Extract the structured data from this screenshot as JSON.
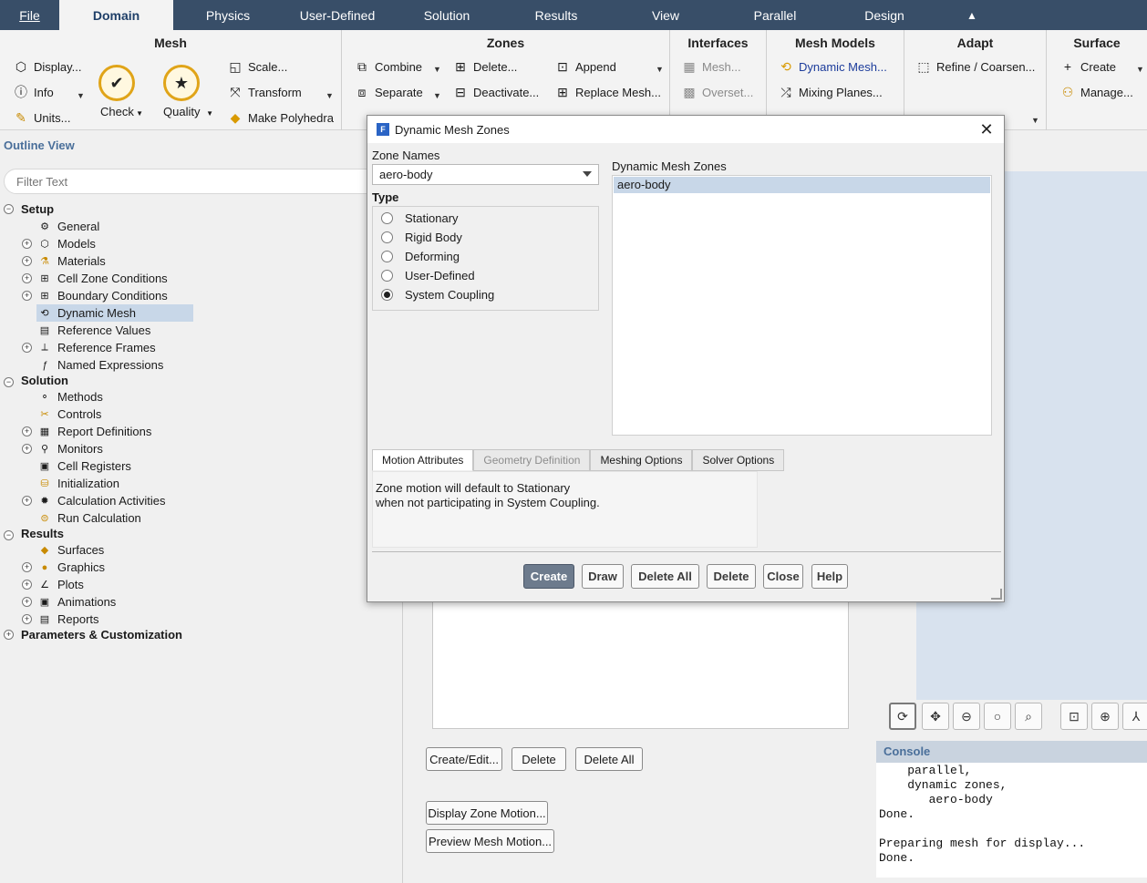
{
  "menu": {
    "tabs": [
      "File",
      "Domain",
      "Physics",
      "User-Defined",
      "Solution",
      "Results",
      "View",
      "Parallel",
      "Design"
    ],
    "active": "Domain",
    "collapse_glyph": "▲"
  },
  "ribbon": {
    "mesh": {
      "title": "Mesh",
      "display": "Display...",
      "info": "Info",
      "units": "Units...",
      "check": "Check",
      "quality": "Quality",
      "scale": "Scale...",
      "transform": "Transform",
      "polyhedra": "Make Polyhedra"
    },
    "zones": {
      "title": "Zones",
      "combine": "Combine",
      "separate": "Separate",
      "delete": "Delete...",
      "deactivate": "Deactivate...",
      "append": "Append",
      "replace_mesh": "Replace Mesh..."
    },
    "interfaces": {
      "title": "Interfaces",
      "mesh": "Mesh...",
      "overset": "Overset..."
    },
    "mesh_models": {
      "title": "Mesh Models",
      "dynamic_mesh": "Dynamic Mesh...",
      "mixing_planes": "Mixing Planes..."
    },
    "adapt": {
      "title": "Adapt",
      "refine": "Refine / Coarsen..."
    },
    "surface": {
      "title": "Surface",
      "create": "Create",
      "manage": "Manage..."
    }
  },
  "outline": {
    "title": "Outline View",
    "filter_placeholder": "Filter Text",
    "nodes": [
      {
        "label": "Setup"
      },
      {
        "label": "General"
      },
      {
        "label": "Models"
      },
      {
        "label": "Materials"
      },
      {
        "label": "Cell Zone Conditions"
      },
      {
        "label": "Boundary Conditions"
      },
      {
        "label": "Dynamic Mesh"
      },
      {
        "label": "Reference Values"
      },
      {
        "label": "Reference Frames"
      },
      {
        "label": "Named Expressions"
      },
      {
        "label": "Solution"
      },
      {
        "label": "Methods"
      },
      {
        "label": "Controls"
      },
      {
        "label": "Report Definitions"
      },
      {
        "label": "Monitors"
      },
      {
        "label": "Cell Registers"
      },
      {
        "label": "Initialization"
      },
      {
        "label": "Calculation Activities"
      },
      {
        "label": "Run Calculation"
      },
      {
        "label": "Results"
      },
      {
        "label": "Surfaces"
      },
      {
        "label": "Graphics"
      },
      {
        "label": "Plots"
      },
      {
        "label": "Animations"
      },
      {
        "label": "Reports"
      },
      {
        "label": "Parameters & Customization"
      }
    ]
  },
  "task_page": {
    "create_edit": "Create/Edit...",
    "delete": "Delete",
    "delete_all": "Delete All",
    "display_zone_motion": "Display Zone Motion...",
    "preview_mesh_motion": "Preview Mesh Motion..."
  },
  "console": {
    "title": "Console",
    "text": "    parallel,\n    dynamic zones,\n       aero-body\nDone.\n\nPreparing mesh for display...\nDone."
  },
  "dialog": {
    "title": "Dynamic Mesh Zones",
    "app_icon": "F",
    "zone_names_label": "Zone Names",
    "zone_name_value": "aero-body",
    "type_label": "Type",
    "types": [
      "Stationary",
      "Rigid Body",
      "Deforming",
      "User-Defined",
      "System Coupling"
    ],
    "selected_type": "System Coupling",
    "dmz_label": "Dynamic Mesh Zones",
    "dmz_items": [
      "aero-body"
    ],
    "tabs": [
      "Motion Attributes",
      "Geometry Definition",
      "Meshing Options",
      "Solver Options"
    ],
    "active_tab": "Motion Attributes",
    "motion_text_1": "Zone motion will default to Stationary",
    "motion_text_2": "when not participating in System Coupling.",
    "buttons": [
      "Create",
      "Draw",
      "Delete All",
      "Delete",
      "Close",
      "Help"
    ]
  },
  "colors": {
    "menubar": "#384e68",
    "accent": "#4a6f9a",
    "selection": "#c8d7e8",
    "primary_button": "#6d7b8d"
  }
}
